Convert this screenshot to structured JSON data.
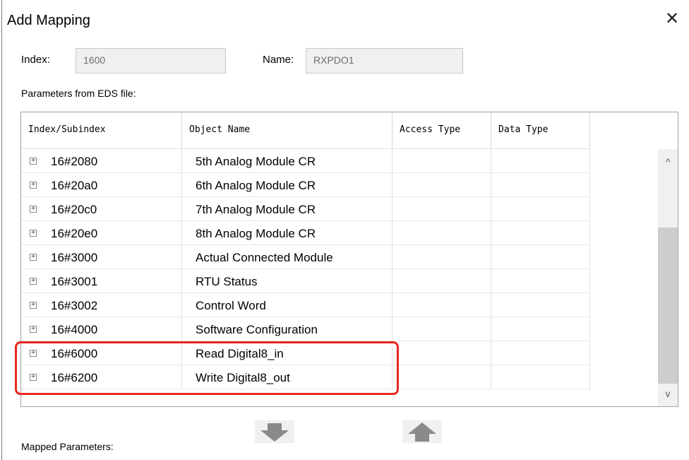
{
  "dialog": {
    "title": "Add Mapping",
    "close_glyph": "✕"
  },
  "fields": {
    "index_label": "Index:",
    "index_value": "1600",
    "name_label": "Name:",
    "name_value": "RXPDO1"
  },
  "eds_label": "Parameters from EDS file:",
  "columns": [
    "Index/Subindex",
    "Object Name",
    "Access Type",
    "Data Type"
  ],
  "rows": [
    {
      "index": "16#2080",
      "name": "5th Analog Module CR"
    },
    {
      "index": "16#20a0",
      "name": "6th Analog Module CR"
    },
    {
      "index": "16#20c0",
      "name": "7th Analog Module CR"
    },
    {
      "index": "16#20e0",
      "name": "8th Analog Module CR"
    },
    {
      "index": "16#3000",
      "name": "Actual Connected Module"
    },
    {
      "index": "16#3001",
      "name": "RTU Status"
    },
    {
      "index": "16#3002",
      "name": "Control Word"
    },
    {
      "index": "16#4000",
      "name": "Software Configuration"
    },
    {
      "index": "16#6000",
      "name": "Read Digital8_in"
    },
    {
      "index": "16#6200",
      "name": "Write Digital8_out"
    }
  ],
  "expander_glyph": "+",
  "scroll": {
    "up_glyph": "^",
    "down_glyph": "v"
  },
  "mapped_label": "Mapped Parameters:",
  "colors": {
    "highlight": "#e8271f",
    "move_arrow": "#8a8a8a",
    "thumb": "#cdcdcd"
  },
  "icons": {
    "move_down": "arrow-down-icon",
    "move_up": "arrow-up-icon"
  }
}
